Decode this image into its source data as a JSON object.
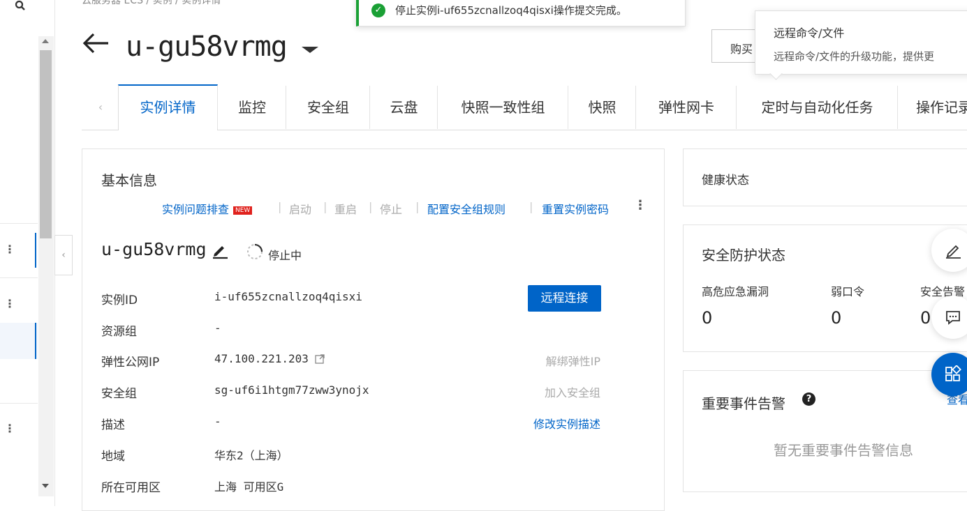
{
  "breadcrumb": {
    "text": "云服务器 ECS  /  实例  /  实例详情"
  },
  "header": {
    "back_icon": "arrow-left-icon",
    "title": "u-gu58vrmg",
    "buy_button": "购买"
  },
  "toast": {
    "message": "停止实例i-uf655zcnallzoq4qisxi操作提交完成。"
  },
  "tooltip": {
    "title": "远程命令/文件",
    "desc": "远程命令/文件的升级功能，提供更"
  },
  "tabs": [
    {
      "label": "实例详情"
    },
    {
      "label": "监控"
    },
    {
      "label": "安全组"
    },
    {
      "label": "云盘"
    },
    {
      "label": "快照一致性组"
    },
    {
      "label": "快照"
    },
    {
      "label": "弹性网卡"
    },
    {
      "label": "定时与自动化任务"
    },
    {
      "label": "操作记录"
    }
  ],
  "basic": {
    "title": "基本信息",
    "actions": {
      "troubleshoot": "实例问题排查",
      "new_badge": "NEW",
      "start": "启动",
      "restart": "重启",
      "stop": "停止",
      "config_sg": "配置安全组规则",
      "reset_pwd": "重置实例密码"
    },
    "instance_name": "u-gu58vrmg",
    "status": "停止中",
    "remote_button": "远程连接",
    "rows": [
      {
        "label": "实例ID",
        "value": "i-uf655zcnallzoq4qisxi",
        "link": ""
      },
      {
        "label": "资源组",
        "value": "-",
        "link": ""
      },
      {
        "label": "弹性公网IP",
        "value": "47.100.221.203",
        "link": "解绑弹性IP"
      },
      {
        "label": "安全组",
        "value": "sg-uf6i1htgm77zww3ynojx",
        "link": "加入安全组"
      },
      {
        "label": "描述",
        "value": "-",
        "link": "修改实例描述"
      },
      {
        "label": "地域",
        "value": "华东2（上海）",
        "link": ""
      },
      {
        "label": "所在可用区",
        "value": "上海 可用区G",
        "link": ""
      }
    ]
  },
  "health": {
    "title": "健康状态"
  },
  "security": {
    "title": "安全防护状态",
    "metrics": [
      {
        "label": "高危应急漏洞",
        "value": "0"
      },
      {
        "label": "弱口令",
        "value": "0"
      },
      {
        "label": "安全告警",
        "value": "0"
      }
    ]
  },
  "events": {
    "title": "重要事件告警",
    "view": "查看",
    "empty": "暂无重要事件告警信息"
  },
  "colors": {
    "accent": "#0064c8",
    "success": "#1aa035",
    "badge": "#e0211c"
  }
}
